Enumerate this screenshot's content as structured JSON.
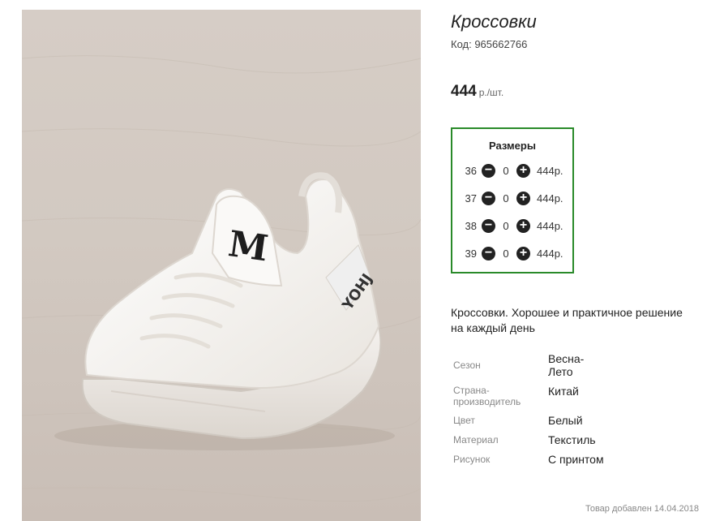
{
  "product": {
    "title": "Кроссовки",
    "code": "Код: 965662766",
    "price": "444",
    "price_unit": "р./шт.",
    "description": "Кроссовки. Хорошее и практичное решение на каждый день",
    "added": "Товар добавлен 14.04.2018"
  },
  "sizes": {
    "heading": "Размеры",
    "rows": [
      {
        "size": "36",
        "qty": "0",
        "price": "444р."
      },
      {
        "size": "37",
        "qty": "0",
        "price": "444р."
      },
      {
        "size": "38",
        "qty": "0",
        "price": "444р."
      },
      {
        "size": "39",
        "qty": "0",
        "price": "444р."
      }
    ],
    "minus_icon": "minus-circle-icon",
    "plus_icon": "plus-circle-icon",
    "accent_color": "#2a8a2a"
  },
  "specs": [
    {
      "label": "Сезон",
      "value": "Весна-Лето"
    },
    {
      "label": "Страна-производитель",
      "value": "Китай"
    },
    {
      "label": "Цвет",
      "value": "Белый"
    },
    {
      "label": "Материал",
      "value": "Текстиль"
    },
    {
      "label": "Рисунок",
      "value": "С принтом"
    }
  ],
  "photo": {
    "logo_text": "M",
    "side_text": "YOHJ"
  }
}
